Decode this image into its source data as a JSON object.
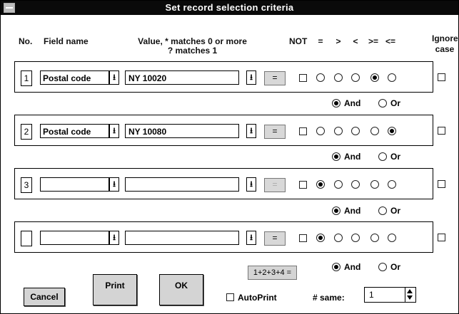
{
  "window": {
    "title": "Set record selection criteria"
  },
  "headers": {
    "no": "No.",
    "field_name": "Field name",
    "value_line1": "Value, * matches 0 or more",
    "value_line2": "? matches 1",
    "not": "NOT",
    "ops": [
      "=",
      ">",
      "<",
      ">=",
      "<="
    ],
    "ignore_line1": "Ignore",
    "ignore_line2": "case"
  },
  "rows": [
    {
      "number": "1",
      "field": "Postal code",
      "value": "NY 10020",
      "eq_label": "=",
      "eq_enabled": true,
      "not_checked": false,
      "op_selected": ">=",
      "ignore_case": false
    },
    {
      "number": "2",
      "field": "Postal code",
      "value": "NY 10080",
      "eq_label": "=",
      "eq_enabled": true,
      "not_checked": false,
      "op_selected": "<=",
      "ignore_case": false
    },
    {
      "number": "3",
      "field": "",
      "value": "",
      "eq_label": "=",
      "eq_enabled": false,
      "not_checked": false,
      "op_selected": "=",
      "ignore_case": false
    },
    {
      "number": "",
      "field": "",
      "value": "",
      "eq_label": "=",
      "eq_enabled": true,
      "not_checked": false,
      "op_selected": "=",
      "ignore_case": false
    }
  ],
  "conjunctions": [
    {
      "and_label": "And",
      "or_label": "Or",
      "selected": "And"
    },
    {
      "and_label": "And",
      "or_label": "Or",
      "selected": "And"
    },
    {
      "and_label": "And",
      "or_label": "Or",
      "selected": "And"
    },
    {
      "and_label": "And",
      "or_label": "Or",
      "selected": "And"
    }
  ],
  "footer": {
    "combine_label": "1+2+3+4 =",
    "cancel_label": "Cancel",
    "print_label": "Print",
    "ok_label": "OK",
    "autoprint_label": "AutoPrint",
    "autoprint_checked": false,
    "same_label": "# same:",
    "same_value": "1"
  }
}
